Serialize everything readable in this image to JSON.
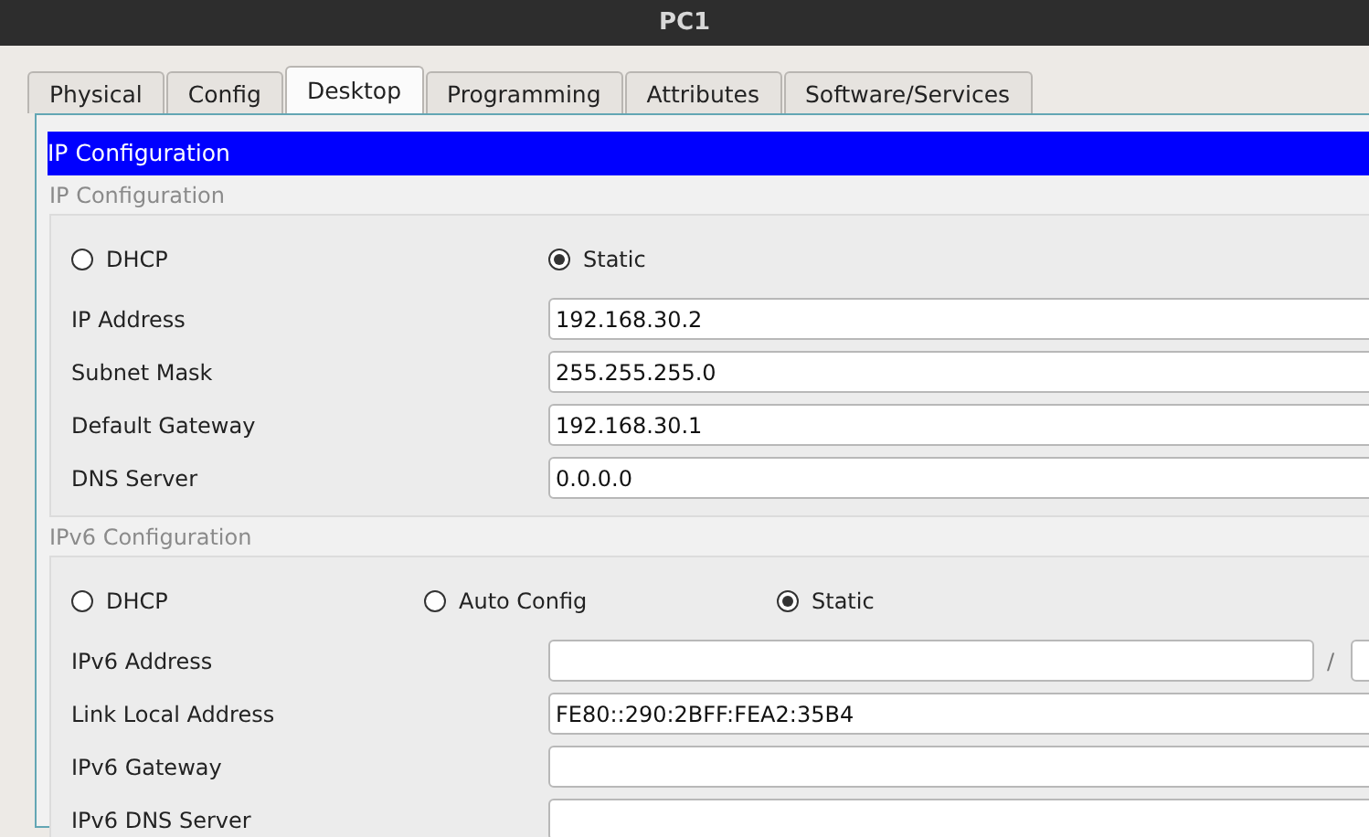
{
  "window": {
    "title": "PC1"
  },
  "tabs": [
    {
      "label": "Physical",
      "selected": false
    },
    {
      "label": "Config",
      "selected": false
    },
    {
      "label": "Desktop",
      "selected": true
    },
    {
      "label": "Programming",
      "selected": false
    },
    {
      "label": "Attributes",
      "selected": false
    },
    {
      "label": "Software/Services",
      "selected": false
    }
  ],
  "header": "IP Configuration",
  "groups": [
    {
      "title": "IP Configuration",
      "modes": [
        {
          "label": "DHCP",
          "selected": false
        },
        {
          "label": "Static",
          "selected": true
        }
      ],
      "fields": [
        {
          "kind": "text",
          "label": "IP Address",
          "value": "192.168.30.2"
        },
        {
          "kind": "text",
          "label": "Subnet Mask",
          "value": "255.255.255.0"
        },
        {
          "kind": "text",
          "label": "Default Gateway",
          "value": "192.168.30.1"
        },
        {
          "kind": "text",
          "label": "DNS Server",
          "value": "0.0.0.0"
        }
      ]
    },
    {
      "title": "IPv6 Configuration",
      "modes": [
        {
          "label": "DHCP",
          "selected": false
        },
        {
          "label": "Auto Config",
          "selected": false
        },
        {
          "label": "Static",
          "selected": true
        }
      ],
      "fields": [
        {
          "kind": "prefixed",
          "label": "IPv6 Address",
          "separator": "/"
        },
        {
          "kind": "text",
          "label": "Link Local Address",
          "value": "FE80::290:2BFF:FEA2:35B4"
        },
        {
          "kind": "text",
          "label": "IPv6 Gateway"
        },
        {
          "kind": "text",
          "label": "IPv6 DNS Server"
        }
      ]
    }
  ]
}
